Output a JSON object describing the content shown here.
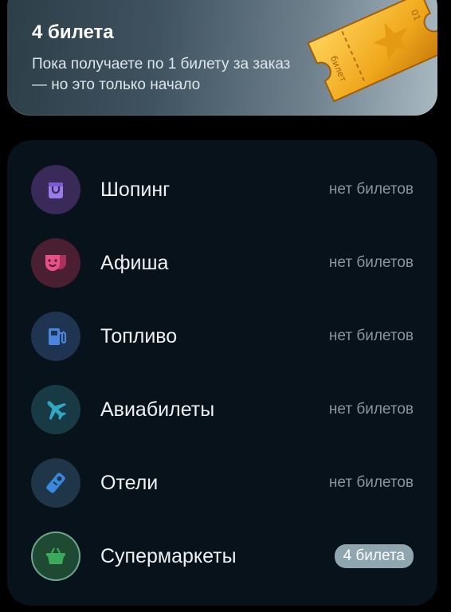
{
  "banner": {
    "title": "4 билета",
    "subtitle": "Пока получаете по 1 билету за заказ — но это только начало",
    "ticket_text": "билет",
    "ticket_number": "01"
  },
  "categories": [
    {
      "label": "Шопинг",
      "status": "нет билетов",
      "icon": "shopping-bag-icon",
      "bg": "#3a2a5a",
      "color": "#9b7be8"
    },
    {
      "label": "Афиша",
      "status": "нет билетов",
      "icon": "theater-masks-icon",
      "bg": "#4a1f32",
      "color": "#e8508a"
    },
    {
      "label": "Топливо",
      "status": "нет билетов",
      "icon": "fuel-pump-icon",
      "bg": "#1f3450",
      "color": "#4a86e0"
    },
    {
      "label": "Авиабилеты",
      "status": "нет билетов",
      "icon": "airplane-icon",
      "bg": "#173a44",
      "color": "#30a8c4"
    },
    {
      "label": "Отели",
      "status": "нет билетов",
      "icon": "door-hanger-icon",
      "bg": "#1e3648",
      "color": "#3a88e0"
    },
    {
      "label": "Супермаркеты",
      "status": "4 билета",
      "icon": "shopping-basket-icon",
      "bg": "#1e4a34",
      "color": "#3caa5c"
    }
  ]
}
